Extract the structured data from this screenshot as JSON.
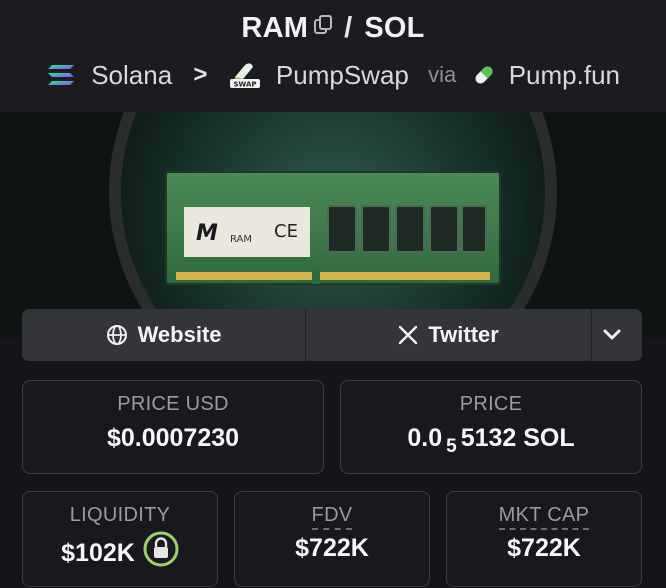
{
  "pair": {
    "base": "RAM",
    "separator": "/",
    "quote": "SOL"
  },
  "meta": {
    "chain": "Solana",
    "dex": "PumpSwap",
    "via": "via",
    "launchpad": "Pump.fun"
  },
  "banner": {
    "chip_label": "RAM",
    "chip_mark": "CE"
  },
  "links": {
    "website": "Website",
    "twitter": "Twitter"
  },
  "stats": {
    "price_usd": {
      "label": "PRICE USD",
      "value": "$0.0007230"
    },
    "price": {
      "label": "PRICE",
      "prefix": "0.0",
      "zeros": "5",
      "suffix": "5132 SOL"
    },
    "liquidity": {
      "label": "LIQUIDITY",
      "value": "$102K"
    },
    "fdv": {
      "label": "FDV",
      "value": "$722K"
    },
    "mkt_cap": {
      "label": "MKT CAP",
      "value": "$722K"
    }
  },
  "colors": {
    "accent_green": "#9ed36a",
    "solana_gradient": [
      "#9945ff",
      "#14f195"
    ]
  }
}
